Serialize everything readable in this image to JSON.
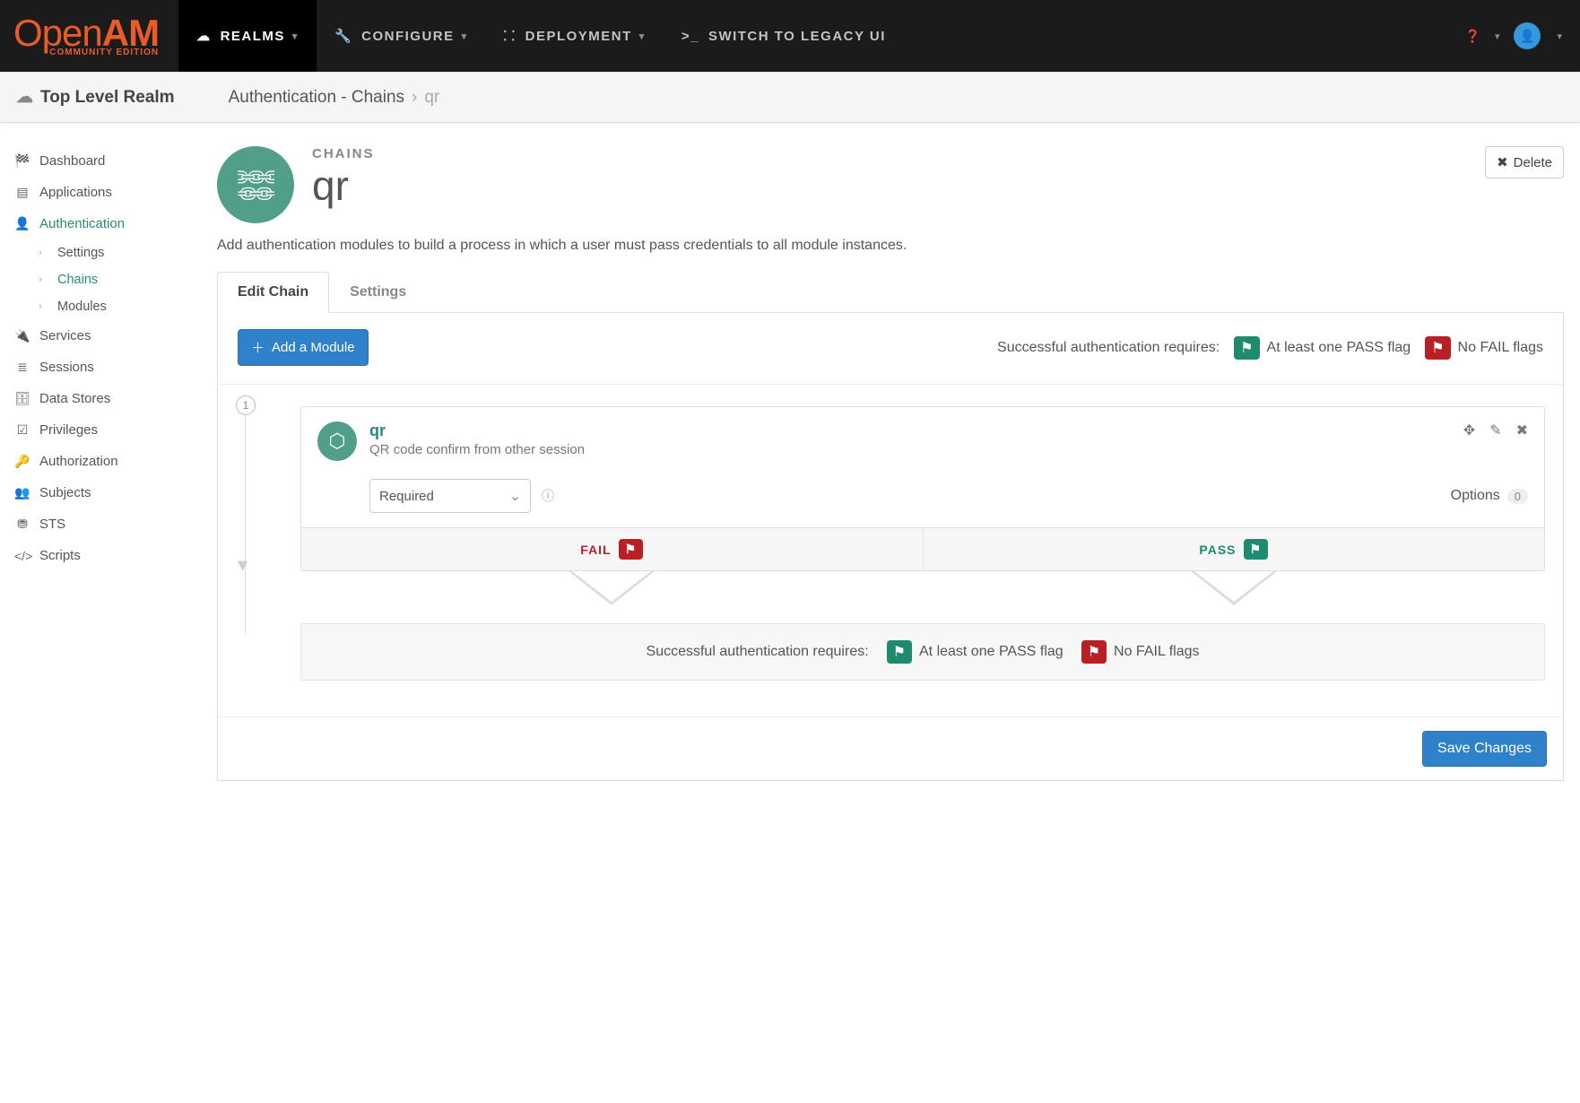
{
  "navbar": {
    "logo_main": "Open",
    "logo_em": "AM",
    "logo_sub": "COMMUNITY EDITION",
    "items": [
      {
        "label": "REALMS",
        "active": true,
        "icon": "cloud"
      },
      {
        "label": "CONFIGURE",
        "active": false,
        "icon": "wrench"
      },
      {
        "label": "DEPLOYMENT",
        "active": false,
        "icon": "sitemap"
      },
      {
        "label": "SWITCH TO LEGACY UI",
        "active": false,
        "icon": "console"
      }
    ]
  },
  "subheader": {
    "realm": "Top Level Realm",
    "breadcrumb_root": "Authentication - Chains",
    "breadcrumb_leaf": "qr"
  },
  "sidebar": {
    "items": [
      {
        "label": "Dashboard",
        "icon": "gauge"
      },
      {
        "label": "Applications",
        "icon": "window"
      },
      {
        "label": "Authentication",
        "icon": "user",
        "active": true,
        "children": [
          {
            "label": "Settings"
          },
          {
            "label": "Chains",
            "active": true
          },
          {
            "label": "Modules"
          }
        ]
      },
      {
        "label": "Services",
        "icon": "plug"
      },
      {
        "label": "Sessions",
        "icon": "layers"
      },
      {
        "label": "Data Stores",
        "icon": "db"
      },
      {
        "label": "Privileges",
        "icon": "check"
      },
      {
        "label": "Authorization",
        "icon": "key"
      },
      {
        "label": "Subjects",
        "icon": "group"
      },
      {
        "label": "STS",
        "icon": "tower"
      },
      {
        "label": "Scripts",
        "icon": "code"
      }
    ]
  },
  "header": {
    "eyebrow": "CHAINS",
    "title": "qr",
    "delete_label": "Delete",
    "description": "Add authentication modules to build a process in which a user must pass credentials to all module instances."
  },
  "tabs": {
    "edit": "Edit Chain",
    "settings": "Settings"
  },
  "toolbar": {
    "add_module": "Add a Module",
    "requires_label": "Successful authentication requires:",
    "pass_flag": "At least one PASS flag",
    "fail_flag": "No FAIL flags"
  },
  "module": {
    "index": "1",
    "name": "qr",
    "desc": "QR code confirm from other session",
    "criteria": "Required",
    "options_label": "Options",
    "options_count": "0",
    "fail_label": "FAIL",
    "pass_label": "PASS"
  },
  "summary": {
    "requires_label": "Successful authentication requires:",
    "pass_flag": "At least one PASS flag",
    "fail_flag": "No FAIL flags"
  },
  "footer": {
    "save_label": "Save Changes"
  }
}
